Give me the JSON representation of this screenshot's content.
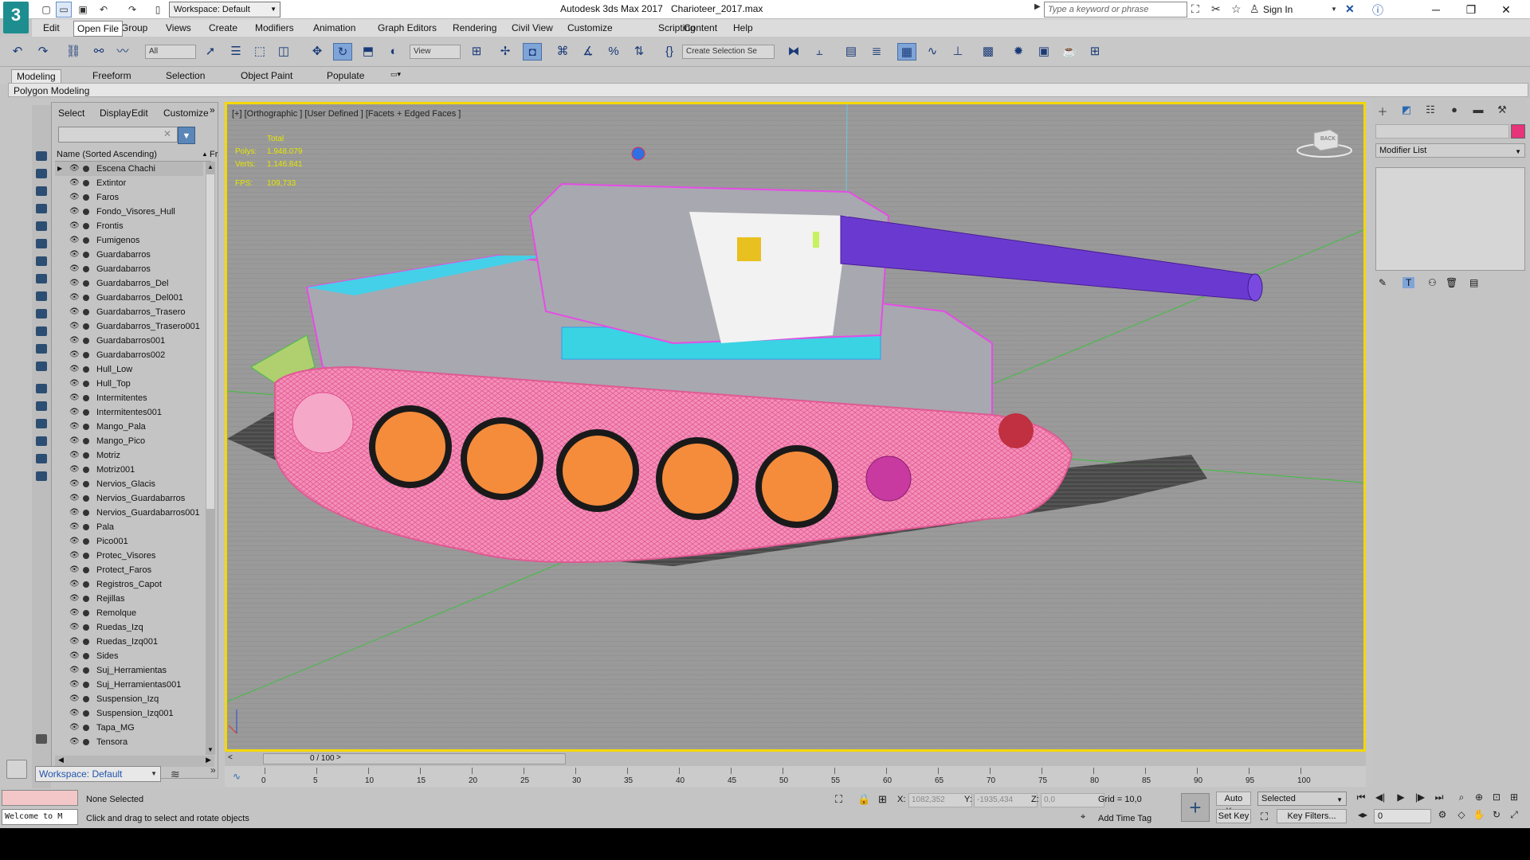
{
  "titlebar": {
    "workspace": "Workspace: Default",
    "app_title": "Autodesk 3ds Max 2017",
    "doc_title": "Charioteer_2017.max",
    "search_placeholder": "Type a keyword or phrase",
    "sign_in": "Sign In"
  },
  "menu": {
    "items": [
      "Edit",
      "Group",
      "Views",
      "Create",
      "Modifiers",
      "Animation",
      "Graph Editors",
      "Rendering",
      "Civil View",
      "Customize",
      "Scripting",
      "Content",
      "Help"
    ],
    "tooltip": "Open File"
  },
  "toolbar": {
    "filter": "All",
    "ref_coord": "View",
    "selection_set": "Create Selection Se"
  },
  "ribbon": {
    "tabs": [
      "Modeling",
      "Freeform",
      "Selection",
      "Object Paint",
      "Populate"
    ],
    "active_tab": "Modeling",
    "panel_label": "Polygon Modeling"
  },
  "explorer": {
    "tabs": [
      "Select",
      "Display",
      "Edit",
      "Customize"
    ],
    "column_header": "Name (Sorted Ascending)",
    "column_header_right": "Fr",
    "items": [
      "Escena Chachi",
      "Extintor",
      "Faros",
      "Fondo_Visores_Hull",
      "Frontis",
      "Fumigenos",
      "Guardabarros",
      "Guardabarros",
      "Guardabarros_Del",
      "Guardabarros_Del001",
      "Guardabarros_Trasero",
      "Guardabarros_Trasero001",
      "Guardabarros001",
      "Guardabarros002",
      "Hull_Low",
      "Hull_Top",
      "Intermitentes",
      "Intermitentes001",
      "Mango_Pala",
      "Mango_Pico",
      "Motriz",
      "Motriz001",
      "Nervios_Glacis",
      "Nervios_Guardabarros",
      "Nervios_Guardabarros001",
      "Pala",
      "Pico001",
      "Protec_Visores",
      "Protect_Faros",
      "Registros_Capot",
      "Rejillas",
      "Remolque",
      "Ruedas_Izq",
      "Ruedas_Izq001",
      "Sides",
      "Suj_Herramientas",
      "Suj_Herramientas001",
      "Suspension_Izq",
      "Suspension_Izq001",
      "Tapa_MG",
      "Tensora"
    ],
    "workspace": "Workspace: Default"
  },
  "viewport": {
    "label": "[+] [Orthographic ] [User Defined ] [Facets + Edged Faces ]",
    "stats_total": "Total",
    "polys_label": "Polys:",
    "polys_value": "1.948.079",
    "verts_label": "Verts:",
    "verts_value": "1.146.841",
    "fps_label": "FPS:",
    "fps_value": "109,733",
    "viewcube_label": "BACK",
    "colors": {
      "border": "#f5d800",
      "stats": "#e5e500"
    }
  },
  "command_panel": {
    "modifier_list": "Modifier List",
    "object_color": "#e6337a"
  },
  "timeline": {
    "frame_counter": "0 / 100",
    "ticks": [
      "0",
      "5",
      "10",
      "15",
      "20",
      "25",
      "30",
      "35",
      "40",
      "45",
      "50",
      "55",
      "60",
      "65",
      "70",
      "75",
      "80",
      "85",
      "90",
      "95",
      "100"
    ]
  },
  "status": {
    "welcome": "Welcome to M",
    "selection": "None Selected",
    "prompt": "Click and drag to select and rotate objects",
    "x_label": "X:",
    "x_value": "1082,352",
    "y_label": "Y:",
    "y_value": "-1935,434",
    "z_label": "Z:",
    "z_value": "0,0",
    "grid": "Grid = 10,0",
    "add_time_tag": "Add Time Tag",
    "auto_key": "Auto Key",
    "set_key": "Set Key",
    "selected_dropdown": "Selected",
    "key_filters": "Key Filters...",
    "frame": "0"
  }
}
